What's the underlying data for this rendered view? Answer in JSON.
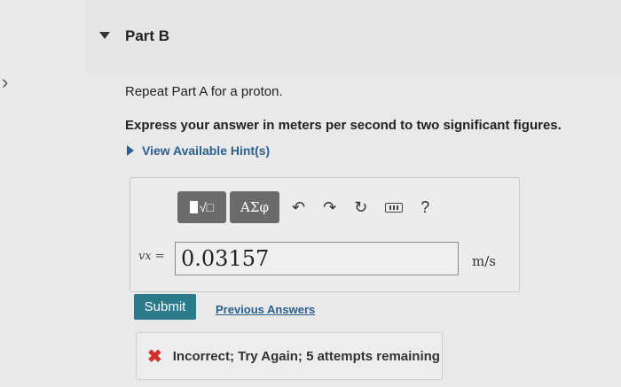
{
  "nav": {
    "side_chevron": "›"
  },
  "part": {
    "title": "Part B",
    "caret_icon": "triangle-down-icon"
  },
  "question": {
    "text": "Repeat Part A for a proton.",
    "instruction": "Express your answer in meters per second to two significant figures."
  },
  "hint": {
    "label": "View Available Hint(s)",
    "icon": "triangle-right-icon"
  },
  "toolbar": {
    "templates_label": "√□",
    "greek_label": "ΑΣφ",
    "undo_icon": "↶",
    "redo_icon": "↷",
    "reset_icon": "↻",
    "help_label": "?"
  },
  "answer": {
    "variable_label": "vx =",
    "value": "0.03157",
    "units": "m/s"
  },
  "actions": {
    "submit_label": "Submit",
    "previous_answers_label": "Previous Answers"
  },
  "feedback": {
    "icon": "✖",
    "text": "Incorrect; Try Again; 5 attempts remaining",
    "color": "#d0312d"
  }
}
